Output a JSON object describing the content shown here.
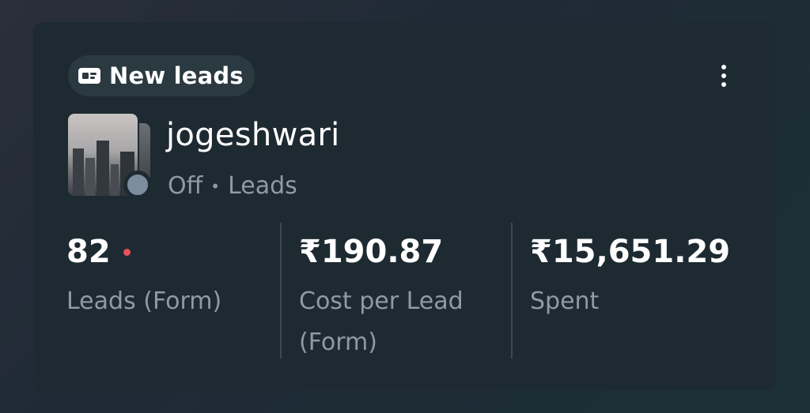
{
  "badge": {
    "icon": "lead-form-icon",
    "label": "New leads"
  },
  "menu": {
    "icon": "more-vertical-icon"
  },
  "campaign": {
    "name": "jogeshwari",
    "status": "Off",
    "separator": "•",
    "objective": "Leads",
    "status_color": "#7d8da0"
  },
  "metrics": [
    {
      "value": "82",
      "label": "Leads (Form)",
      "alert_dot": true
    },
    {
      "value": "₹190.87",
      "label_line1": "Cost per Lead",
      "label_line2": "(Form)"
    },
    {
      "value": "₹15,651.29",
      "label": "Spent"
    }
  ],
  "colors": {
    "card_bg": "#1e2a31",
    "muted_text": "#8f9ba3",
    "alert": "#e8505b"
  }
}
